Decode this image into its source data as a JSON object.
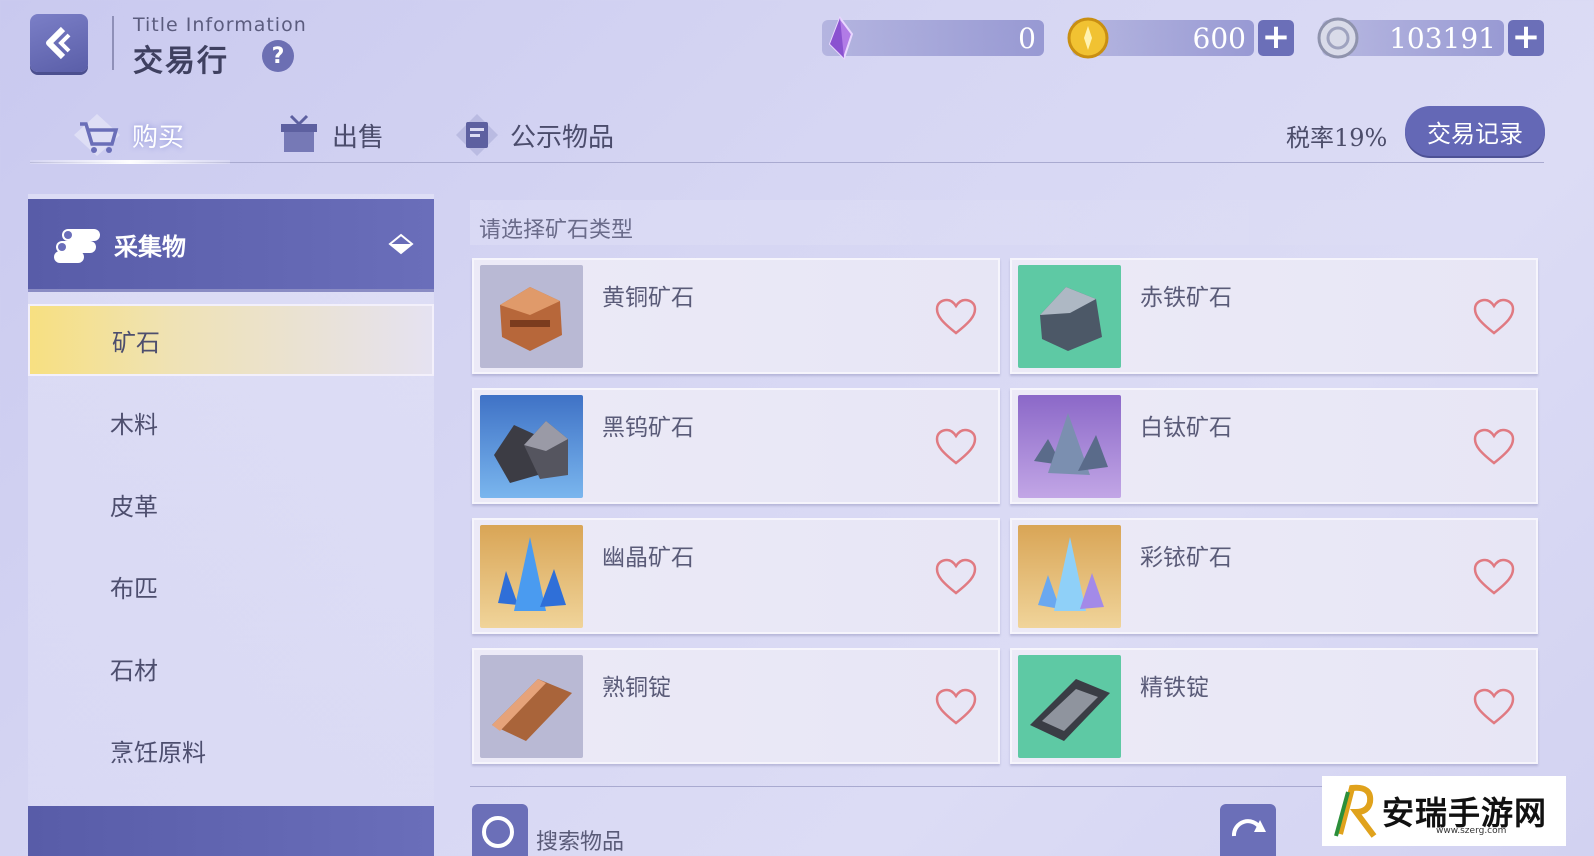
{
  "header": {
    "title_en": "Title  Information",
    "title_cn": "交易行",
    "help_label": "?"
  },
  "currencies": [
    {
      "name": "crystal",
      "icon": "purple-crystal-icon",
      "value": "0",
      "has_plus": false
    },
    {
      "name": "gold",
      "icon": "gold-coin-icon",
      "value": "600",
      "has_plus": true
    },
    {
      "name": "silver",
      "icon": "silver-coin-icon",
      "value": "103191",
      "has_plus": true
    }
  ],
  "tabs": [
    {
      "label": "购买",
      "icon": "shopping-cart-icon",
      "active": true
    },
    {
      "label": "出售",
      "icon": "gift-box-icon",
      "active": false
    },
    {
      "label": "公示物品",
      "icon": "notice-board-icon",
      "active": false
    }
  ],
  "tax_rate": "税率19%",
  "trade_record_label": "交易记录",
  "sidebar": {
    "category": "采集物",
    "items": [
      {
        "label": "矿石",
        "active": true
      },
      {
        "label": "木料",
        "active": false
      },
      {
        "label": "皮革",
        "active": false
      },
      {
        "label": "布匹",
        "active": false
      },
      {
        "label": "石材",
        "active": false
      },
      {
        "label": "烹饪原料",
        "active": false
      }
    ]
  },
  "content": {
    "section_title": "请选择矿石类型",
    "items": [
      {
        "name": "黄铜矿石",
        "thumb_bg": "#b9b9d4",
        "icon": "copper-ore-icon"
      },
      {
        "name": "赤铁矿石",
        "thumb_bg": "#5ec9a4",
        "icon": "iron-ore-icon"
      },
      {
        "name": "黑钨矿石",
        "thumb_bg": "#5a92d8",
        "icon": "tungsten-ore-icon"
      },
      {
        "name": "白钛矿石",
        "thumb_bg": "#a484d6",
        "icon": "titanium-ore-icon"
      },
      {
        "name": "幽晶矿石",
        "thumb_bg": "#e2b467",
        "icon": "blue-crystal-icon"
      },
      {
        "name": "彩铱矿石",
        "thumb_bg": "#e6b870",
        "icon": "rainbow-crystal-icon"
      },
      {
        "name": "熟铜锭",
        "thumb_bg": "#b9b9d4",
        "icon": "copper-ingot-icon"
      },
      {
        "name": "精铁锭",
        "thumb_bg": "#5ec9a4",
        "icon": "iron-ingot-icon"
      }
    ],
    "search_label": "搜索物品"
  },
  "watermark": {
    "text": "安瑞手游网",
    "sub": "www.szerg.com"
  }
}
